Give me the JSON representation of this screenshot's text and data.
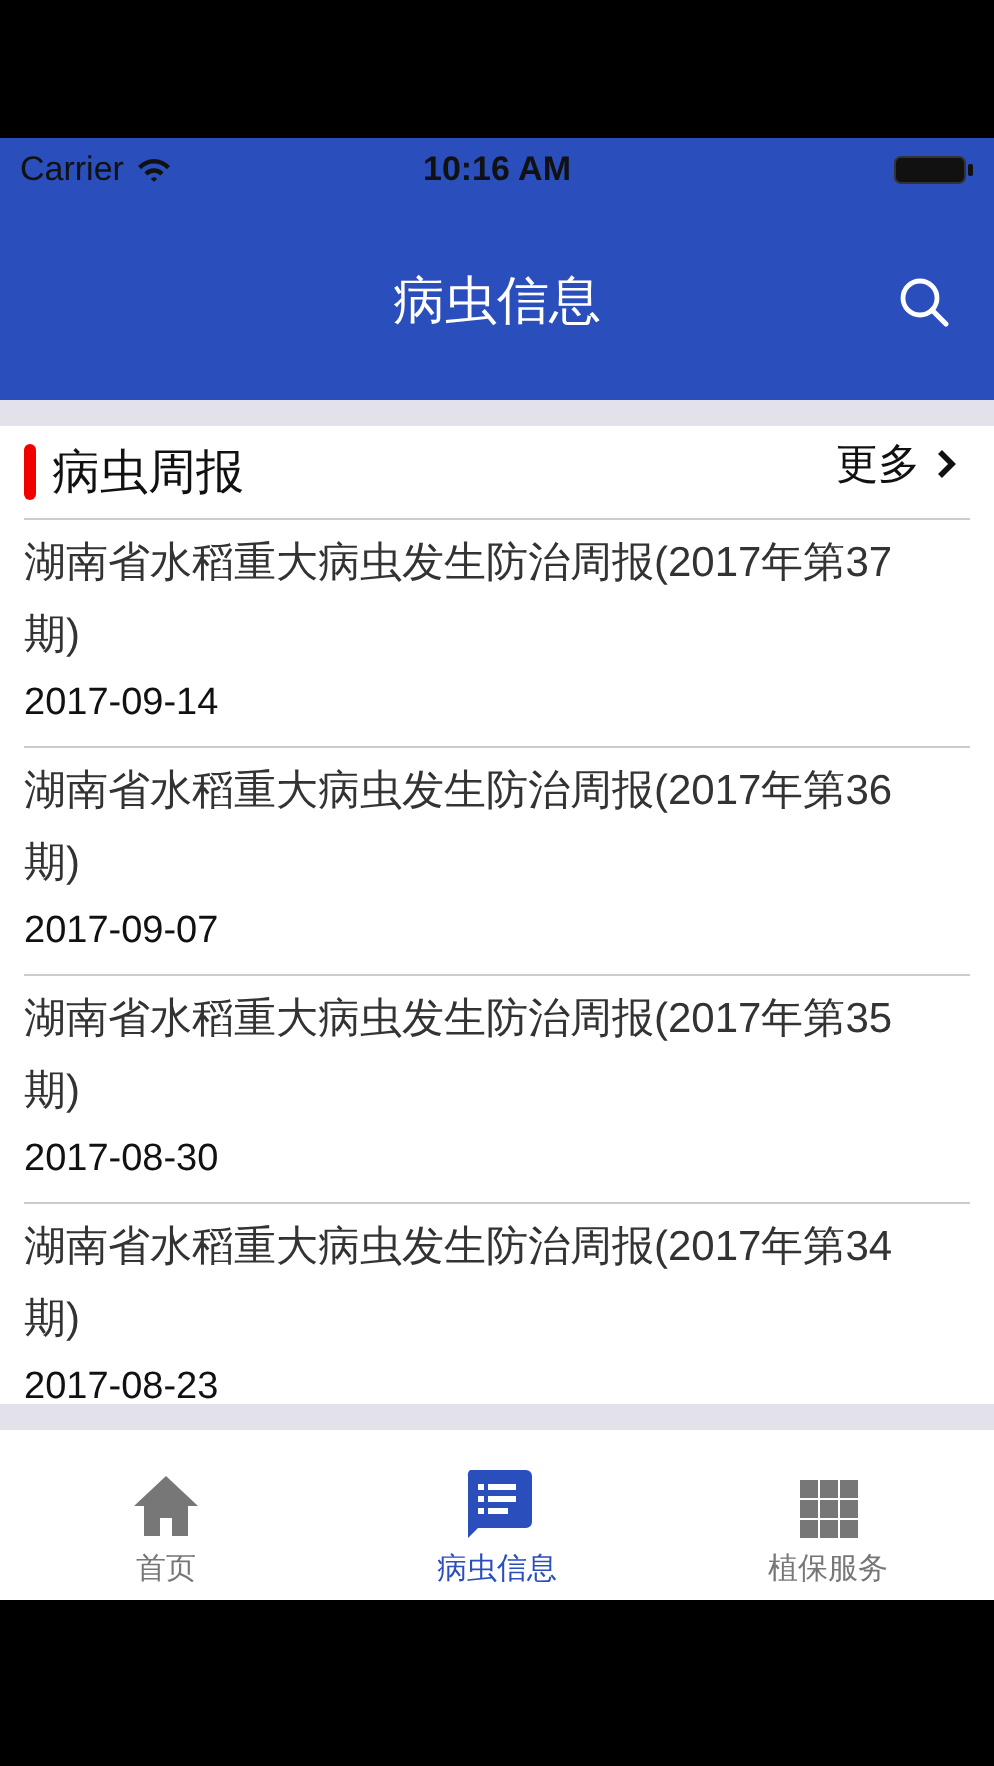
{
  "status_bar": {
    "carrier": "Carrier",
    "time": "10:16 AM"
  },
  "nav": {
    "title": "病虫信息"
  },
  "section": {
    "title": "病虫周报",
    "more": "更多",
    "items": [
      {
        "title": "湖南省水稻重大病虫发生防治周报(2017年第37期)",
        "date": "2017-09-14"
      },
      {
        "title": "湖南省水稻重大病虫发生防治周报(2017年第36期)",
        "date": "2017-09-07"
      },
      {
        "title": "湖南省水稻重大病虫发生防治周报(2017年第35期)",
        "date": "2017-08-30"
      },
      {
        "title": "湖南省水稻重大病虫发生防治周报(2017年第34期)",
        "date": "2017-08-23"
      }
    ]
  },
  "tabs": [
    {
      "kind": "home",
      "label": "首页",
      "selected": false
    },
    {
      "kind": "list",
      "label": "病虫信息",
      "selected": true
    },
    {
      "kind": "grid",
      "label": "植保服务",
      "selected": false
    }
  ]
}
